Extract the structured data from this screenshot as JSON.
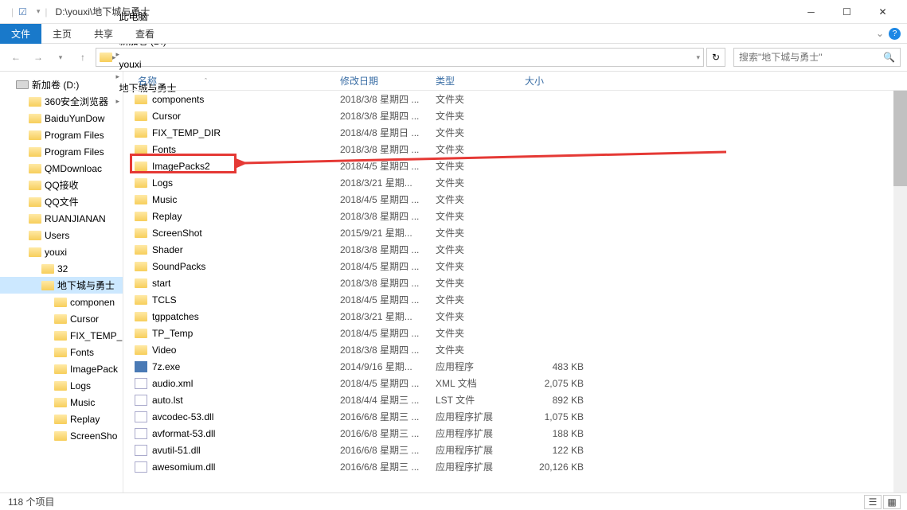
{
  "title_path": "D:\\youxi\\地下城与勇士",
  "ribbon": {
    "file": "文件",
    "home": "主页",
    "share": "共享",
    "view": "查看"
  },
  "breadcrumbs": [
    "此电脑",
    "新加卷 (D:)",
    "youxi",
    "地下城与勇士"
  ],
  "search_placeholder": "搜索\"地下城与勇士\"",
  "columns": {
    "name": "名称",
    "date": "修改日期",
    "type": "类型",
    "size": "大小"
  },
  "tree": [
    {
      "label": "新加卷 (D:)",
      "level": 0,
      "icon": "drive"
    },
    {
      "label": "360安全浏览器",
      "level": 1,
      "icon": "folder"
    },
    {
      "label": "BaiduYunDow",
      "level": 1,
      "icon": "folder"
    },
    {
      "label": "Program Files",
      "level": 1,
      "icon": "folder"
    },
    {
      "label": "Program Files",
      "level": 1,
      "icon": "folder"
    },
    {
      "label": "QMDownloac",
      "level": 1,
      "icon": "folder"
    },
    {
      "label": "QQ接收",
      "level": 1,
      "icon": "folder"
    },
    {
      "label": "QQ文件",
      "level": 1,
      "icon": "folder"
    },
    {
      "label": "RUANJIANAN",
      "level": 1,
      "icon": "folder"
    },
    {
      "label": "Users",
      "level": 1,
      "icon": "folder"
    },
    {
      "label": "youxi",
      "level": 1,
      "icon": "folder"
    },
    {
      "label": "32",
      "level": 2,
      "icon": "folder"
    },
    {
      "label": "地下城与勇士",
      "level": 2,
      "icon": "folder",
      "selected": true
    },
    {
      "label": "componen",
      "level": 3,
      "icon": "folder"
    },
    {
      "label": "Cursor",
      "level": 3,
      "icon": "folder"
    },
    {
      "label": "FIX_TEMP_",
      "level": 3,
      "icon": "folder"
    },
    {
      "label": "Fonts",
      "level": 3,
      "icon": "folder"
    },
    {
      "label": "ImagePack",
      "level": 3,
      "icon": "folder"
    },
    {
      "label": "Logs",
      "level": 3,
      "icon": "folder"
    },
    {
      "label": "Music",
      "level": 3,
      "icon": "folder"
    },
    {
      "label": "Replay",
      "level": 3,
      "icon": "folder"
    },
    {
      "label": "ScreenSho",
      "level": 3,
      "icon": "folder"
    }
  ],
  "files": [
    {
      "name": "components",
      "date": "2018/3/8 星期四 ...",
      "type": "文件夹",
      "size": "",
      "icon": "folder"
    },
    {
      "name": "Cursor",
      "date": "2018/3/8 星期四 ...",
      "type": "文件夹",
      "size": "",
      "icon": "folder"
    },
    {
      "name": "FIX_TEMP_DIR",
      "date": "2018/4/8 星期日 ...",
      "type": "文件夹",
      "size": "",
      "icon": "folder"
    },
    {
      "name": "Fonts",
      "date": "2018/3/8 星期四 ...",
      "type": "文件夹",
      "size": "",
      "icon": "folder"
    },
    {
      "name": "ImagePacks2",
      "date": "2018/4/5 星期四 ...",
      "type": "文件夹",
      "size": "",
      "icon": "folder",
      "highlight": true
    },
    {
      "name": "Logs",
      "date": "2018/3/21 星期...",
      "type": "文件夹",
      "size": "",
      "icon": "folder"
    },
    {
      "name": "Music",
      "date": "2018/4/5 星期四 ...",
      "type": "文件夹",
      "size": "",
      "icon": "folder"
    },
    {
      "name": "Replay",
      "date": "2018/3/8 星期四 ...",
      "type": "文件夹",
      "size": "",
      "icon": "folder"
    },
    {
      "name": "ScreenShot",
      "date": "2015/9/21 星期...",
      "type": "文件夹",
      "size": "",
      "icon": "folder"
    },
    {
      "name": "Shader",
      "date": "2018/3/8 星期四 ...",
      "type": "文件夹",
      "size": "",
      "icon": "folder"
    },
    {
      "name": "SoundPacks",
      "date": "2018/4/5 星期四 ...",
      "type": "文件夹",
      "size": "",
      "icon": "folder"
    },
    {
      "name": "start",
      "date": "2018/3/8 星期四 ...",
      "type": "文件夹",
      "size": "",
      "icon": "folder"
    },
    {
      "name": "TCLS",
      "date": "2018/4/5 星期四 ...",
      "type": "文件夹",
      "size": "",
      "icon": "folder"
    },
    {
      "name": "tgppatches",
      "date": "2018/3/21 星期...",
      "type": "文件夹",
      "size": "",
      "icon": "folder"
    },
    {
      "name": "TP_Temp",
      "date": "2018/4/5 星期四 ...",
      "type": "文件夹",
      "size": "",
      "icon": "folder"
    },
    {
      "name": "Video",
      "date": "2018/3/8 星期四 ...",
      "type": "文件夹",
      "size": "",
      "icon": "folder"
    },
    {
      "name": "7z.exe",
      "date": "2014/9/16 星期...",
      "type": "应用程序",
      "size": "483 KB",
      "icon": "exe"
    },
    {
      "name": "audio.xml",
      "date": "2018/4/5 星期四 ...",
      "type": "XML 文档",
      "size": "2,075 KB",
      "icon": "file"
    },
    {
      "name": "auto.lst",
      "date": "2018/4/4 星期三 ...",
      "type": "LST 文件",
      "size": "892 KB",
      "icon": "file"
    },
    {
      "name": "avcodec-53.dll",
      "date": "2016/6/8 星期三 ...",
      "type": "应用程序扩展",
      "size": "1,075 KB",
      "icon": "file"
    },
    {
      "name": "avformat-53.dll",
      "date": "2016/6/8 星期三 ...",
      "type": "应用程序扩展",
      "size": "188 KB",
      "icon": "file"
    },
    {
      "name": "avutil-51.dll",
      "date": "2016/6/8 星期三 ...",
      "type": "应用程序扩展",
      "size": "122 KB",
      "icon": "file"
    },
    {
      "name": "awesomium.dll",
      "date": "2016/6/8 星期三 ...",
      "type": "应用程序扩展",
      "size": "20,126 KB",
      "icon": "file"
    }
  ],
  "status": "118 个项目"
}
